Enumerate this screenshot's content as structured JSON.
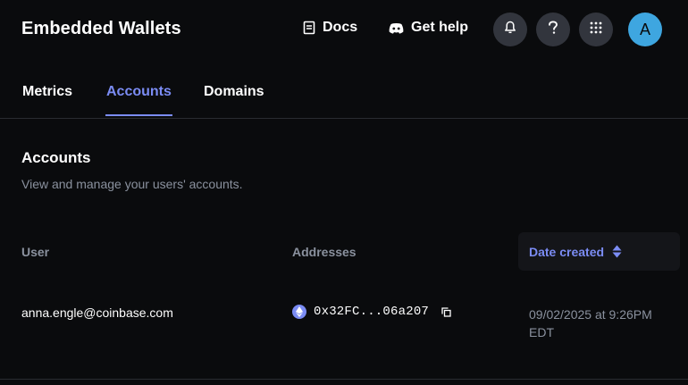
{
  "header": {
    "title": "Embedded Wallets",
    "docs_label": "Docs",
    "help_label": "Get help",
    "avatar_initial": "A"
  },
  "tabs": [
    {
      "label": "Metrics",
      "active": false
    },
    {
      "label": "Accounts",
      "active": true
    },
    {
      "label": "Domains",
      "active": false
    }
  ],
  "section": {
    "title": "Accounts",
    "description": "View and manage your users' accounts."
  },
  "table": {
    "columns": {
      "user": "User",
      "addresses": "Addresses",
      "date_created": "Date created"
    },
    "rows": [
      {
        "user": "anna.engle@coinbase.com",
        "address": "0x32FC...06a207",
        "date_line1": "09/02/2025 at 9:26PM",
        "date_line2": "EDT"
      }
    ]
  },
  "colors": {
    "background": "#0a0b0d",
    "accent": "#7b8cf4",
    "muted_text": "#8a919e",
    "icon_button_bg": "#32353d",
    "avatar_bg": "#3ea6e0"
  },
  "icons": [
    "docs-icon",
    "discord-icon",
    "bell-icon",
    "help-icon",
    "apps-grid-icon",
    "sort-icon",
    "ethereum-icon",
    "copy-icon"
  ]
}
